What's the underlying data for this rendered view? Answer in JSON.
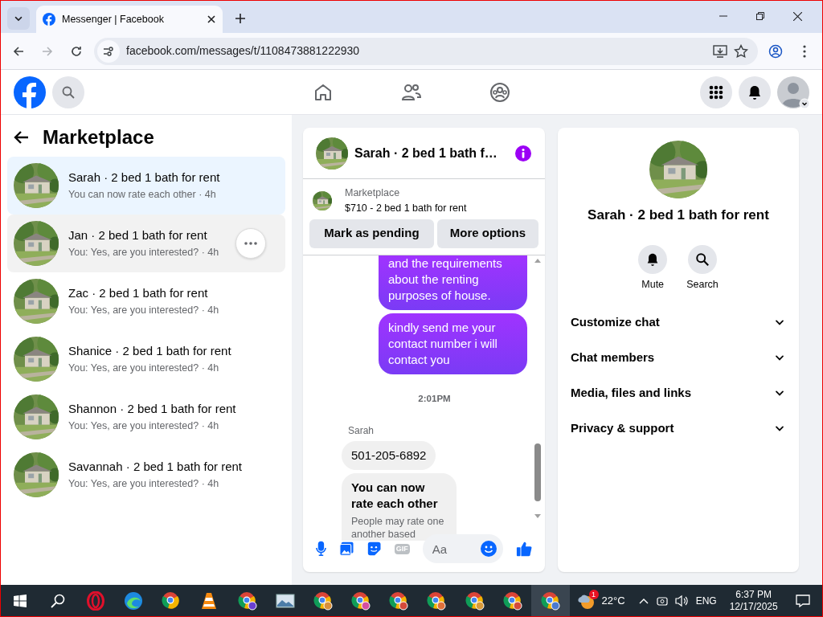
{
  "browser": {
    "tab_title": "Messenger | Facebook",
    "url": "facebook.com/messages/t/1108473881222930"
  },
  "sidebar": {
    "title": "Marketplace",
    "conversations": [
      {
        "name": "Sarah · 2 bed 1 bath for rent",
        "preview": "You can now rate each other · 4h",
        "selected": true,
        "hovered": false
      },
      {
        "name": "Jan · 2 bed 1 bath for rent",
        "preview": "You: Yes, are you interested? · 4h",
        "selected": false,
        "hovered": true
      },
      {
        "name": "Zac · 2 bed 1 bath for rent",
        "preview": "You: Yes, are you interested? · 4h",
        "selected": false,
        "hovered": false
      },
      {
        "name": "Shanice · 2 bed 1 bath for rent",
        "preview": "You: Yes, are you interested? · 4h",
        "selected": false,
        "hovered": false
      },
      {
        "name": "Shannon · 2 bed 1 bath for rent",
        "preview": "You: Yes, are you interested? · 4h",
        "selected": false,
        "hovered": false
      },
      {
        "name": "Savannah · 2 bed 1 bath for rent",
        "preview": "You: Yes, are you interested? · 4h",
        "selected": false,
        "hovered": false
      }
    ]
  },
  "chat": {
    "title": "Sarah · 2 bed 1 bath f…",
    "listing": {
      "label": "Marketplace",
      "summary": "$710 - 2 bed 1 bath for rent"
    },
    "actions": [
      "Mark as pending",
      "More options"
    ],
    "messages": [
      {
        "kind": "outgoing",
        "text": "and the requirements about the renting purposes of house."
      },
      {
        "kind": "outgoing",
        "text": "kindly send me your contact number i will contact you"
      },
      {
        "kind": "timestamp",
        "text": "2:01PM"
      },
      {
        "kind": "sender",
        "text": "Sarah"
      },
      {
        "kind": "incoming",
        "text": "501-205-6892"
      },
      {
        "kind": "notice",
        "title": "You can now rate each other",
        "text": "People may rate one another based"
      }
    ],
    "composer": {
      "placeholder": "Aa",
      "gif_label": "GIF"
    }
  },
  "details": {
    "name": "Sarah · 2 bed 1 bath for rent",
    "actions": [
      "Mute",
      "Search"
    ],
    "sections": [
      "Customize chat",
      "Chat members",
      "Media, files and links",
      "Privacy & support"
    ]
  },
  "taskbar": {
    "weather": "22°C",
    "weather_badge": "1",
    "language": "ENG",
    "time": "6:37 PM",
    "date": "12/17/2025"
  }
}
